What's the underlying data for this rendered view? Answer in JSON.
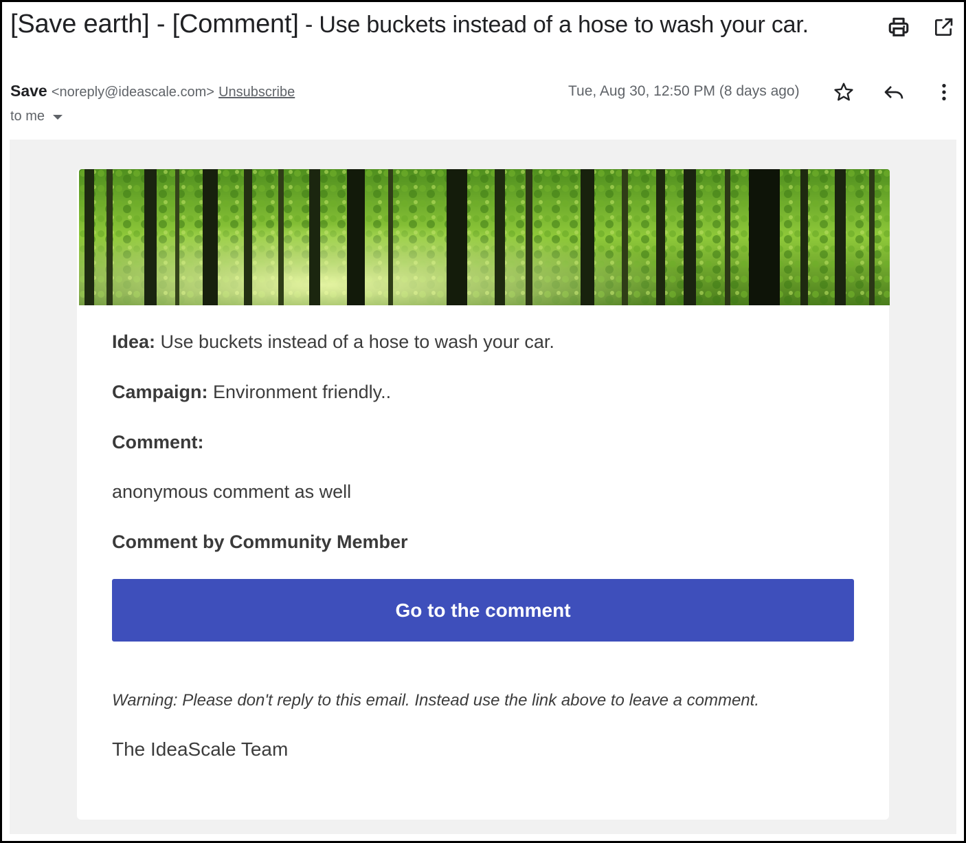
{
  "email": {
    "subject_tags": "[Save earth] - [Comment]",
    "subject_rest": " - Use buckets instead of a hose to wash your car.",
    "sender_name": "Save",
    "sender_email": "<noreply@ideascale.com>",
    "unsubscribe_label": "Unsubscribe",
    "recipient_label": "to me",
    "date": "Tue, Aug 30, 12:50 PM (8 days ago)"
  },
  "body": {
    "idea_label": "Idea:",
    "idea_value": " Use buckets instead of a hose to wash your car.",
    "campaign_label": "Campaign:",
    "campaign_value": " Environment friendly..",
    "comment_label": "Comment:",
    "comment_text": "anonymous comment as well",
    "comment_by": "Comment by Community Member",
    "cta_label": "Go to the comment",
    "warning": "Warning: Please don't reply to this email. Instead use the link above to leave a comment.",
    "signoff": "The IdeaScale Team"
  },
  "icons": [
    "print-icon",
    "open-in-new-window-icon",
    "star-icon",
    "reply-icon",
    "more-vert-icon",
    "dropdown-caret-icon"
  ],
  "colors": {
    "cta": "#3e4fbb",
    "email_background": "#f1f1f1",
    "muted_text": "#5f6368"
  }
}
